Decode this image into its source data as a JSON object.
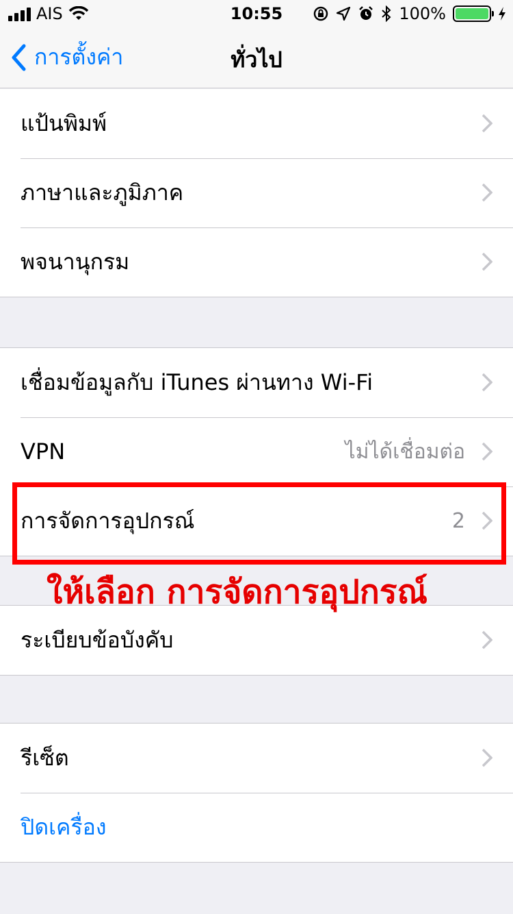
{
  "status_bar": {
    "carrier": "AIS",
    "time": "10:55",
    "battery_percent": "100%",
    "battery_level": 1.0,
    "icons": [
      "signal-icon",
      "wifi-icon",
      "orientation-lock-icon",
      "location-icon",
      "alarm-icon",
      "bluetooth-icon",
      "battery-icon",
      "charging-icon"
    ]
  },
  "nav": {
    "back_label": "การตั้งค่า",
    "title": "ทั่วไป"
  },
  "groups": [
    {
      "rows": [
        {
          "label": "แป้นพิมพ์",
          "detail": ""
        },
        {
          "label": "ภาษาและภูมิภาค",
          "detail": ""
        },
        {
          "label": "พจนานุกรม",
          "detail": ""
        }
      ]
    },
    {
      "rows": [
        {
          "label": "เชื่อมข้อมูลกับ iTunes ผ่านทาง Wi-Fi",
          "detail": ""
        },
        {
          "label": "VPN",
          "detail": "ไม่ได้เชื่อมต่อ"
        },
        {
          "label": "การจัดการอุปกรณ์",
          "detail": "2"
        }
      ]
    },
    {
      "rows": [
        {
          "label": "ระเบียบข้อบังคับ",
          "detail": ""
        }
      ]
    },
    {
      "rows": [
        {
          "label": "รีเซ็ต",
          "detail": ""
        },
        {
          "label": "ปิดเครื่อง",
          "detail": ""
        }
      ]
    }
  ],
  "annotation": {
    "text": "ให้เลือก การจัดการอุปกรณ์",
    "color": "#ff0000"
  },
  "colors": {
    "accent": "#007aff",
    "background": "#efeff4",
    "battery": "#4cd964"
  }
}
